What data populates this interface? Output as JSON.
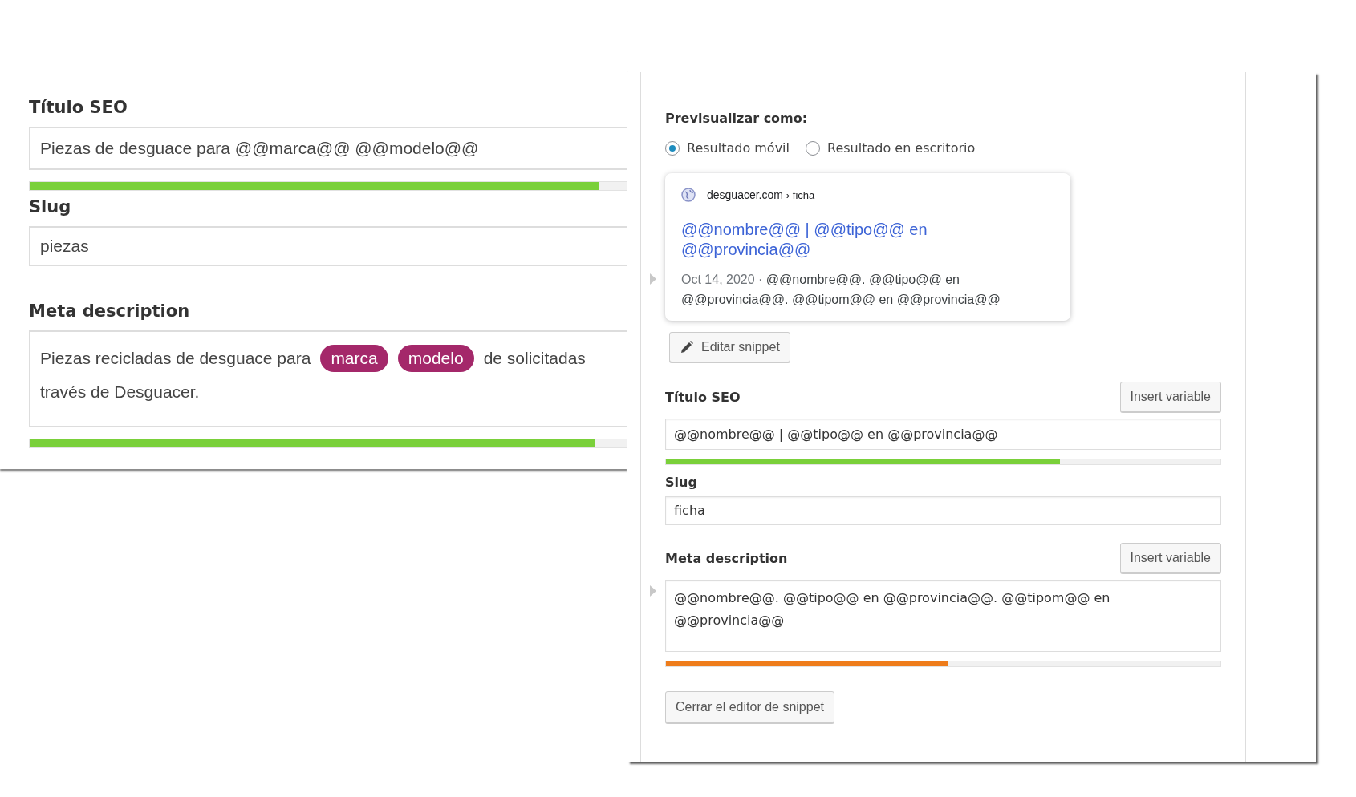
{
  "left_panel": {
    "seo_title": {
      "label": "Título SEO",
      "value": "Piezas de desguace para @@marca@@ @@modelo@@",
      "bar": {
        "level": 0.9,
        "color": "#7ad03a"
      }
    },
    "slug": {
      "label": "Slug",
      "value": "piezas"
    },
    "meta_description": {
      "label": "Meta description",
      "lines": [
        [
          {
            "kind": "text",
            "text": "Piezas recicladas de desguace para"
          },
          {
            "kind": "tag",
            "text": "marca"
          },
          {
            "kind": "tag",
            "text": "modelo"
          },
          {
            "kind": "text",
            "text": "de solicitadas"
          }
        ],
        [
          {
            "kind": "text",
            "text": "través de Desguacer."
          }
        ]
      ],
      "bar": {
        "level": 0.895,
        "color": "#7ad03a"
      }
    }
  },
  "right_panel": {
    "preview": {
      "label": "Previsualizar como:",
      "options": [
        {
          "label": "Resultado móvil",
          "selected": true
        },
        {
          "label": "Resultado en escritorio",
          "selected": false
        }
      ]
    },
    "snippet": {
      "site": "desguacer.com",
      "path": "› ficha",
      "title": "@@nombre@@ | @@tipo@@ en @@provincia@@",
      "date": "Oct 14, 2020 ·",
      "description": "@@nombre@@. @@tipo@@ en @@provincia@@. @@tipom@@ en @@provincia@@"
    },
    "edit_button": "Editar snippet",
    "seo_title": {
      "label": "Título SEO",
      "button": "Insert variable",
      "value": "@@nombre@@ | @@tipo@@ en @@provincia@@",
      "bar": {
        "level": 0.71,
        "color": "#7ad03a"
      }
    },
    "slug": {
      "label": "Slug",
      "value": "ficha"
    },
    "meta_description": {
      "label": "Meta description",
      "button": "Insert variable",
      "value": "@@nombre@@. @@tipo@@ en @@provincia@@. @@tipom@@ en @@provincia@@",
      "bar": {
        "level": 0.51,
        "color": "#ee7c1b"
      }
    },
    "close_button": "Cerrar el editor de snippet"
  }
}
